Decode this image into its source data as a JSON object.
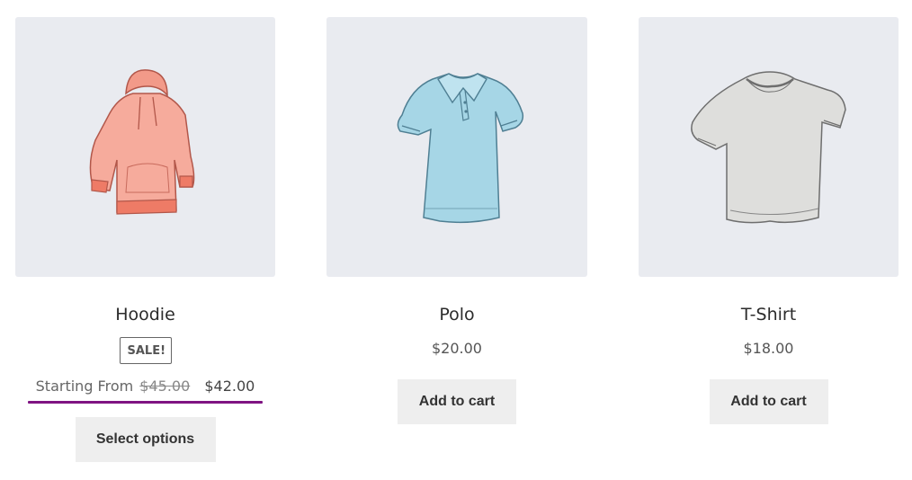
{
  "products": [
    {
      "title": "Hoodie",
      "badge": "SALE!",
      "price_prefix": "Starting From",
      "price_old": "$45.00",
      "price_new": "$42.00",
      "button_label": "Select options",
      "image_icon": "hoodie-image",
      "image_color": "#f4a597"
    },
    {
      "title": "Polo",
      "price": "$20.00",
      "button_label": "Add to cart",
      "image_icon": "polo-shirt-image",
      "image_color": "#9fd3e2"
    },
    {
      "title": "T-Shirt",
      "price": "$18.00",
      "button_label": "Add to cart",
      "image_icon": "tshirt-image",
      "image_color": "#dcdcdc"
    }
  ],
  "colors": {
    "thumbnail_bg": "#e9ebf0",
    "button_bg": "#eeeeee",
    "price_highlight": "#7f1482"
  }
}
